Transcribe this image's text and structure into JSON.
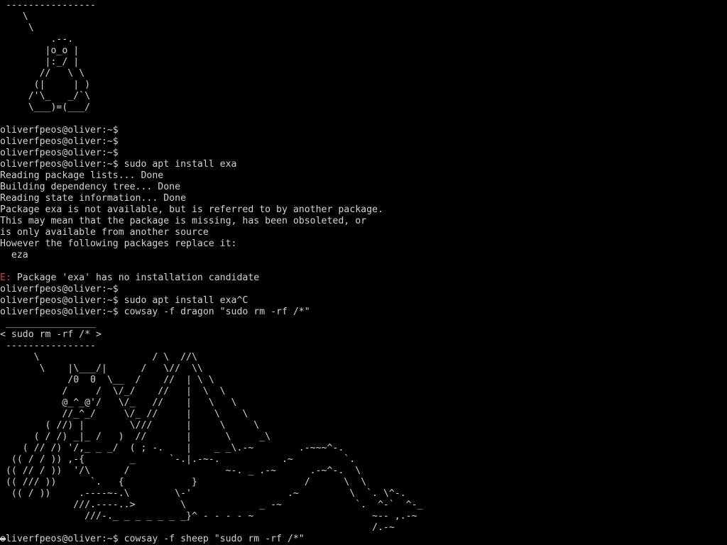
{
  "colors": {
    "background": "#000000",
    "text": "#d3d3d3",
    "error_prefix": "#e03030"
  },
  "terminal": {
    "lines": [
      {
        "text": " ----------------"
      },
      {
        "text": "    \\"
      },
      {
        "text": "     \\"
      },
      {
        "text": "         .--."
      },
      {
        "text": "        |o_o |"
      },
      {
        "text": "        |:_/ |"
      },
      {
        "text": "       //   \\ \\"
      },
      {
        "text": "      (|     | )"
      },
      {
        "text": "     /'\\_   _/`\\"
      },
      {
        "text": "     \\___)=(___/"
      },
      {
        "text": ""
      },
      {
        "text": "oliverfpeos@oliver:~$"
      },
      {
        "text": "oliverfpeos@oliver:~$"
      },
      {
        "text": "oliverfpeos@oliver:~$"
      },
      {
        "text": "oliverfpeos@oliver:~$ sudo apt install exa"
      },
      {
        "text": "Reading package lists... Done"
      },
      {
        "text": "Building dependency tree... Done"
      },
      {
        "text": "Reading state information... Done"
      },
      {
        "text": "Package exa is not available, but is referred to by another package."
      },
      {
        "text": "This may mean that the package is missing, has been obsoleted, or"
      },
      {
        "text": "is only available from another source"
      },
      {
        "text": "However the following packages replace it:"
      },
      {
        "text": "  eza"
      },
      {
        "text": ""
      },
      {
        "prefix": "E:",
        "text": " Package 'exa' has no installation candidate"
      },
      {
        "text": "oliverfpeos@oliver:~$"
      },
      {
        "text": "oliverfpeos@oliver:~$ sudo apt install exa^C"
      },
      {
        "text": "oliverfpeos@oliver:~$ cowsay -f dragon \"sudo rm -rf /*\""
      },
      {
        "text": " ________________"
      },
      {
        "text": "< sudo rm -rf /* >"
      },
      {
        "text": " ----------------"
      },
      {
        "text": "      \\                    / \\  //\\"
      },
      {
        "text": "       \\    |\\___/|      /   \\//  \\\\"
      },
      {
        "text": "            /0  0  \\__  /    //  | \\ \\"
      },
      {
        "text": "           /     /  \\/_/    //   |  \\  \\"
      },
      {
        "text": "           @_^_@'/   \\/_   //    |   \\   \\"
      },
      {
        "text": "           //_^_/     \\/_ //     |    \\    \\"
      },
      {
        "text": "        ( //) |        \\///      |     \\     \\"
      },
      {
        "text": "      ( / /) _|_ /   )  //       |      \\     _\\"
      },
      {
        "text": "    ( // /) '/,_ _ _/  ( ; -.    |    _ _\\.-~        .-~~~^-."
      },
      {
        "text": "  (( / / )) ,-{        _      `-.|.-~-.           .~         `."
      },
      {
        "text": " (( // / ))  '/\\      /                 ~-. _ .-~      .-~^-.  \\"
      },
      {
        "text": " (( /// ))      `.   {            }                   /      \\  \\"
      },
      {
        "text": "  (( / ))     .----~-.\\        \\-'                 .~         \\  `. \\^-."
      },
      {
        "text": "             ///.----..>        \\             _ -~             `.  ^-`  ^-_"
      },
      {
        "text": "               ///-._ _ _ _ _ _ _}^ - - - - ~                     ~-- ,.-~"
      },
      {
        "text": "                                                                  /.-~"
      },
      {
        "text": "oliverfpeos@oliver:~$ cowsay -f sheep \"sudo rm -rf /*\""
      }
    ]
  }
}
